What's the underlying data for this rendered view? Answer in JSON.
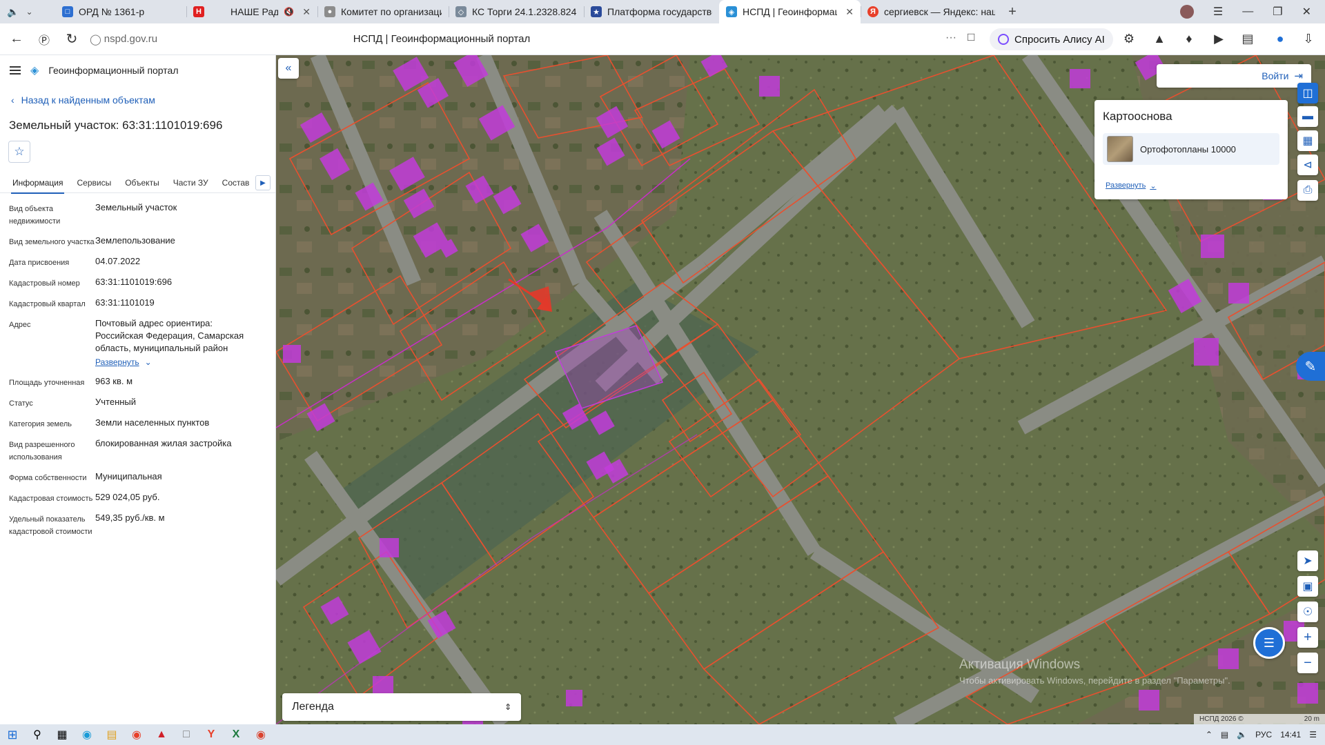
{
  "browser": {
    "tabs": [
      {
        "label": "ОРД № 1361-р",
        "icon": "ord-favicon",
        "color": "#2d6fd1"
      },
      {
        "label": "НАШЕ Радио",
        "icon": "nashe-favicon",
        "color": "#e02020",
        "muted": true
      },
      {
        "label": "Комитет по организации",
        "icon": "emblem-favicon",
        "color": "#8c8c8c"
      },
      {
        "label": "КС Торги 24.1.2328.824",
        "icon": "ks-favicon",
        "color": "#7a8a9a"
      },
      {
        "label": "Платформа государстве",
        "icon": "emblem-favicon",
        "color": "#2a4a9a"
      },
      {
        "label": "НСПД | Геоинформаци",
        "icon": "nspd-favicon",
        "color": "#2a90d6",
        "active": true
      },
      {
        "label": "сергиевск — Яндекс: наш",
        "icon": "yandex-favicon",
        "color": "#e8402a"
      }
    ],
    "url": "nspd.gov.ru",
    "page_title": "НСПД | Геоинформационный портал",
    "alice_label": "Спросить Алису AI"
  },
  "panel": {
    "portal_name": "Геоинформационный портал",
    "back_link": "Назад к найденным объектам",
    "title": "Земельный участок: 63:31:1101019:696",
    "tabs": [
      "Информация",
      "Сервисы",
      "Объекты",
      "Части ЗУ",
      "Состав"
    ],
    "properties": [
      {
        "key": "Вид объекта недвижимости",
        "value": "Земельный участок"
      },
      {
        "key": "Вид земельного участка",
        "value": "Землепользование"
      },
      {
        "key": "Дата присвоения",
        "value": "04.07.2022"
      },
      {
        "key": "Кадастровый номер",
        "value": "63:31:1101019:696"
      },
      {
        "key": "Кадастровый квартал",
        "value": "63:31:1101019"
      },
      {
        "key": "Адрес",
        "value": "Почтовый адрес ориентира: Российская Федерация, Самарская область, муниципальный район",
        "expand": "Развернуть"
      },
      {
        "key": "Площадь уточненная",
        "value": "963 кв. м"
      },
      {
        "key": "Статус",
        "value": "Учтенный"
      },
      {
        "key": "Категория земель",
        "value": "Земли населенных пунктов"
      },
      {
        "key": "Вид разрешенного использования",
        "value": "блокированная жилая застройка"
      },
      {
        "key": "Форма собственности",
        "value": "Муниципальная"
      },
      {
        "key": "Кадастровая стоимость",
        "value": "529 024,05 руб."
      },
      {
        "key": "Удельный показатель кадастровой стоимости",
        "value": "549,35 руб./кв. м"
      }
    ]
  },
  "map": {
    "login_label": "Войти",
    "basemap_header": "Картооснова",
    "basemap_item": "Ортофотопланы 10000",
    "basemap_expand": "Развернуть",
    "legend_label": "Легенда",
    "watermark_line1": "Активация Windows",
    "watermark_line2": "Чтобы активировать Windows, перейдите в раздел \"Параметры\".",
    "copyright": "НСПД 2026 ©",
    "scale": "20 m",
    "colors": {
      "parcel_line": "#e8502f",
      "building_fill": "#c23cdb",
      "accent": "#1f6fd6",
      "boundary": "#c82ec8"
    }
  },
  "taskbar": {
    "language": "РУС",
    "time": "14:41"
  }
}
